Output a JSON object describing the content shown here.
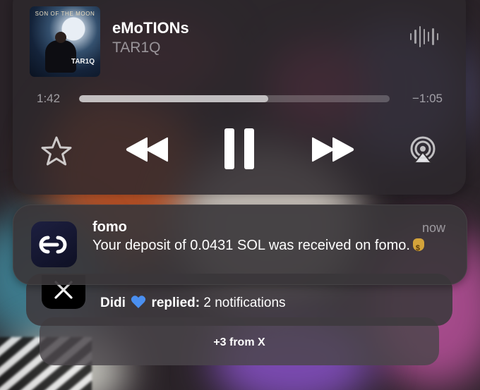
{
  "now_playing": {
    "artwork": {
      "album_title": "SON OF THE MOON",
      "artist_mark": "TAR1Q"
    },
    "title": "eMoTIONs",
    "artist": "TAR1Q",
    "elapsed": "1:42",
    "remaining": "−1:05",
    "progress": 0.61,
    "controls": {
      "favorite_icon": "star-outline-icon",
      "rewind_icon": "backward-icon",
      "play_state_icon": "pause-icon",
      "forward_icon": "forward-icon",
      "output_icon": "airplay-icon",
      "wave_icon": "waveform-icon"
    }
  },
  "notifications": {
    "primary": {
      "app": "fomo",
      "time": "now",
      "body": "Your deposit of 0.0431 SOL was received on fomo.",
      "emoji_icon": "money-bag-icon"
    },
    "stacked": {
      "app_icon": "x-logo-icon",
      "sender": "Didi",
      "heart_icon": "blue-heart-icon",
      "action": "replied:",
      "summary": "2 notifications"
    },
    "more": "+3 from X"
  },
  "colors": {
    "accent_heart": "#4a8ff0",
    "fomo_icon_bg": "#1d1f40"
  }
}
